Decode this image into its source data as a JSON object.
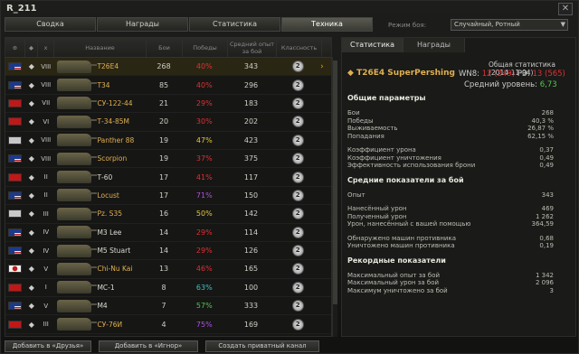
{
  "window": {
    "title": "R_211"
  },
  "tabs": [
    "Сводка",
    "Награды",
    "Статистика",
    "Техника"
  ],
  "active_tab": 3,
  "mode": {
    "label": "Режим боя:",
    "value": "Случайный, Ротный"
  },
  "table": {
    "headers": {
      "name": "Название",
      "battles": "Бои",
      "wins": "Победы",
      "avg_exp": "Средний опыт за бой",
      "mastery": "Классность"
    },
    "rows": [
      {
        "nation": "usa",
        "tier": "VIII",
        "name": "T26E4",
        "premium": true,
        "battles": "268",
        "wins": "40%",
        "wins_color": "red",
        "avg": "343",
        "mastery": "2",
        "selected": true
      },
      {
        "nation": "usa",
        "tier": "VIII",
        "name": "T34",
        "premium": true,
        "battles": "85",
        "wins": "40%",
        "wins_color": "red",
        "avg": "296",
        "mastery": "2"
      },
      {
        "nation": "ussr",
        "tier": "VII",
        "name": "СУ-122-44",
        "premium": true,
        "battles": "21",
        "wins": "29%",
        "wins_color": "red",
        "avg": "183",
        "mastery": "2"
      },
      {
        "nation": "ussr",
        "tier": "VI",
        "name": "Т-34-85М",
        "premium": true,
        "battles": "20",
        "wins": "30%",
        "wins_color": "red",
        "avg": "202",
        "mastery": "2"
      },
      {
        "nation": "germany",
        "tier": "VIII",
        "name": "Panther 88",
        "premium": true,
        "battles": "19",
        "wins": "47%",
        "wins_color": "yellow",
        "avg": "423",
        "mastery": "2"
      },
      {
        "nation": "usa",
        "tier": "VIII",
        "name": "Scorpion",
        "premium": true,
        "battles": "19",
        "wins": "37%",
        "wins_color": "red",
        "avg": "375",
        "mastery": "2"
      },
      {
        "nation": "ussr",
        "tier": "II",
        "name": "Т-60",
        "premium": false,
        "battles": "17",
        "wins": "41%",
        "wins_color": "red",
        "avg": "117",
        "mastery": "2"
      },
      {
        "nation": "usa",
        "tier": "II",
        "name": "Locust",
        "premium": true,
        "battles": "17",
        "wins": "71%",
        "wins_color": "purple",
        "avg": "150",
        "mastery": "2"
      },
      {
        "nation": "germany",
        "tier": "III",
        "name": "Pz. S35",
        "premium": true,
        "battles": "16",
        "wins": "50%",
        "wins_color": "yellow",
        "avg": "142",
        "mastery": "2"
      },
      {
        "nation": "usa",
        "tier": "IV",
        "name": "M3 Lee",
        "premium": false,
        "battles": "14",
        "wins": "29%",
        "wins_color": "red",
        "avg": "114",
        "mastery": "2"
      },
      {
        "nation": "usa",
        "tier": "IV",
        "name": "M5 Stuart",
        "premium": false,
        "battles": "14",
        "wins": "29%",
        "wins_color": "red",
        "avg": "126",
        "mastery": "2"
      },
      {
        "nation": "japan",
        "tier": "V",
        "name": "Chi-Nu Kai",
        "premium": true,
        "battles": "13",
        "wins": "46%",
        "wins_color": "red",
        "avg": "165",
        "mastery": "2"
      },
      {
        "nation": "ussr",
        "tier": "I",
        "name": "МС-1",
        "premium": false,
        "battles": "8",
        "wins": "63%",
        "wins_color": "teal",
        "avg": "100",
        "mastery": "2"
      },
      {
        "nation": "usa",
        "tier": "V",
        "name": "M4",
        "premium": false,
        "battles": "7",
        "wins": "57%",
        "wins_color": "green",
        "avg": "333",
        "mastery": "2"
      },
      {
        "nation": "ussr",
        "tier": "III",
        "name": "СУ-76И",
        "premium": true,
        "battles": "4",
        "wins": "75%",
        "wins_color": "purple",
        "avg": "169",
        "mastery": "2"
      }
    ]
  },
  "panel": {
    "tabs": [
      "Статистика",
      "Награды"
    ],
    "date": "Общая статистика (2014-11-04)",
    "tank": "T26E4 SuperPershing",
    "wn8": {
      "label": "WN8:",
      "value": "12",
      "paren": "(249)",
      "r3_label": "РЭ:",
      "r3": "13",
      "r3_paren": "(565)"
    },
    "avg_level": {
      "label": "Средний уровень:",
      "value": "6,73"
    },
    "sections": [
      {
        "title": "Общие параметры",
        "items": [
          [
            "Бои",
            "268"
          ],
          [
            "Победы",
            "40,3 %"
          ],
          [
            "Выживаемость",
            "26,87 %"
          ],
          [
            "Попадания",
            "62,15 %"
          ]
        ]
      },
      {
        "title": "",
        "items": [
          [
            "Коэффициент урона",
            "0,37"
          ],
          [
            "Коэффициент уничтожения",
            "0,49"
          ],
          [
            "Эффективность использования брони",
            "0,49"
          ]
        ]
      },
      {
        "title": "Средние показатели за бой",
        "items": [
          [
            "Опыт",
            "343"
          ]
        ]
      },
      {
        "title": "",
        "items": [
          [
            "Нанесённый урон",
            "469"
          ],
          [
            "Полученный урон",
            "1 262"
          ],
          [
            "Урон, нанесённый с вашей помощью",
            "364,59"
          ]
        ]
      },
      {
        "title": "",
        "items": [
          [
            "Обнаружено машин противника",
            "0,68"
          ],
          [
            "Уничтожено машин противника",
            "0,19"
          ]
        ]
      },
      {
        "title": "Рекордные показатели",
        "items": [
          [
            "Максимальный опыт за бой",
            "1 342"
          ],
          [
            "Максимальный урон за бой",
            "2 096"
          ],
          [
            "Максимум уничтожено за бой",
            "3"
          ]
        ]
      }
    ]
  },
  "actions": [
    "Добавить в «Друзья»",
    "Добавить в «Игнор»",
    "Создать приватный канал"
  ]
}
